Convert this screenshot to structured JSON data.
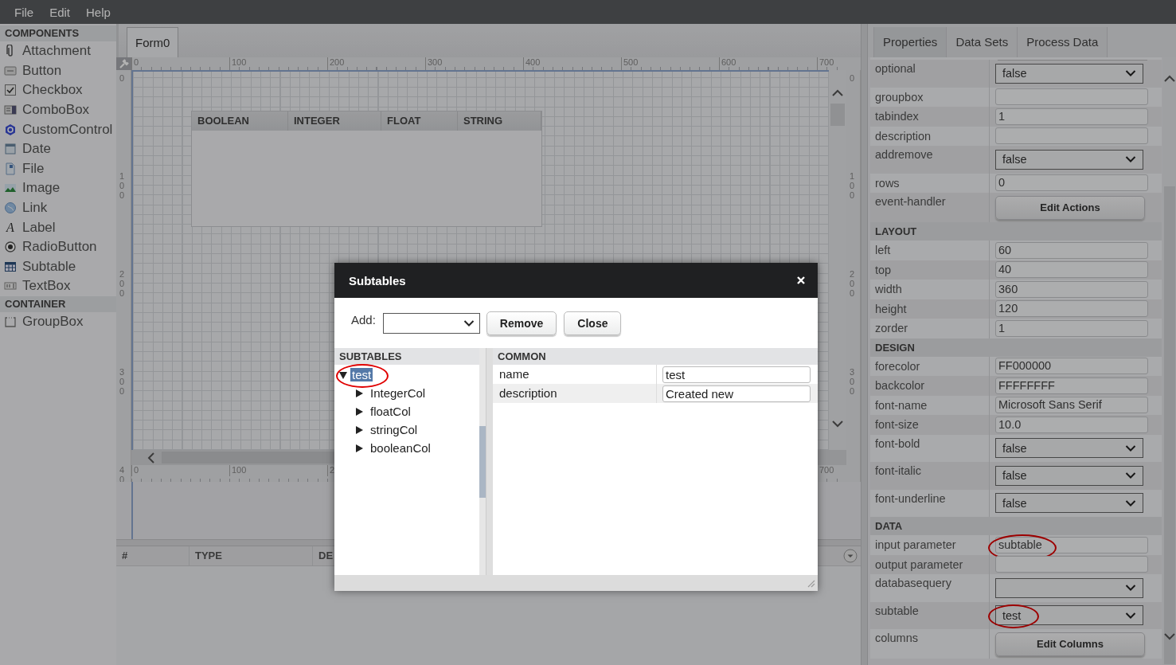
{
  "menu": [
    "File",
    "Edit",
    "Help"
  ],
  "components": {
    "title": "COMPONENTS",
    "items": [
      {
        "label": "Attachment",
        "kind": "attachment"
      },
      {
        "label": "Button",
        "kind": "button"
      },
      {
        "label": "Checkbox",
        "kind": "checkbox"
      },
      {
        "label": "ComboBox",
        "kind": "combobox"
      },
      {
        "label": "CustomControl",
        "kind": "customcontrol"
      },
      {
        "label": "Date",
        "kind": "date"
      },
      {
        "label": "File",
        "kind": "file"
      },
      {
        "label": "Image",
        "kind": "image"
      },
      {
        "label": "Link",
        "kind": "link"
      },
      {
        "label": "Label",
        "kind": "label",
        "glyph": "A"
      },
      {
        "label": "RadioButton",
        "kind": "radiobutton"
      },
      {
        "label": "Subtable",
        "kind": "subtable"
      },
      {
        "label": "TextBox",
        "kind": "textbox"
      }
    ]
  },
  "container": {
    "title": "CONTAINER",
    "items": [
      {
        "label": "GroupBox",
        "kind": "groupbox"
      }
    ]
  },
  "designer": {
    "tabs": [
      {
        "label": "Form0",
        "selected": true
      }
    ],
    "top_ruler": [
      "0",
      "100",
      "200",
      "300",
      "400",
      "500",
      "600",
      "700"
    ],
    "left_ruler": [
      "0",
      "100",
      "200",
      "300",
      "40"
    ],
    "right_ruler": [
      "0",
      "100",
      "200",
      "300"
    ],
    "bottom_ruler": [
      "0",
      "100",
      "2",
      "700"
    ],
    "subtable_columns": [
      "BOOLEAN",
      "INTEGER",
      "FLOAT",
      "STRING"
    ]
  },
  "output_table": {
    "columns": [
      "#",
      "TYPE",
      "DE"
    ]
  },
  "properties": {
    "tabs": [
      {
        "label": "Properties",
        "selected": true
      },
      {
        "label": "Data Sets",
        "selected": false
      },
      {
        "label": "Process Data",
        "selected": false
      }
    ],
    "rows": [
      {
        "kind": "select",
        "label": "optional",
        "value": "false"
      },
      {
        "kind": "text",
        "label": "groupbox"
      },
      {
        "kind": "text",
        "label": "tabindex",
        "value": "1"
      },
      {
        "kind": "text",
        "label": "description"
      },
      {
        "kind": "select",
        "label": "addremove",
        "value": "false"
      },
      {
        "kind": "text",
        "label": "rows",
        "value": "0"
      },
      {
        "kind": "button",
        "label": "event-handler",
        "value": "Edit Actions"
      },
      {
        "kind": "section",
        "label": "LAYOUT"
      },
      {
        "kind": "text",
        "label": "left",
        "value": "60"
      },
      {
        "kind": "text",
        "label": "top",
        "value": "40"
      },
      {
        "kind": "text",
        "label": "width",
        "value": "360"
      },
      {
        "kind": "text",
        "label": "height",
        "value": "120"
      },
      {
        "kind": "text",
        "label": "zorder",
        "value": "1"
      },
      {
        "kind": "section",
        "label": "DESIGN"
      },
      {
        "kind": "text",
        "label": "forecolor",
        "value": "FF000000"
      },
      {
        "kind": "text",
        "label": "backcolor",
        "value": "FFFFFFFF"
      },
      {
        "kind": "text",
        "label": "font-name",
        "value": "Microsoft Sans Serif"
      },
      {
        "kind": "text",
        "label": "font-size",
        "value": "10.0"
      },
      {
        "kind": "select",
        "label": "font-bold",
        "value": "false"
      },
      {
        "kind": "select",
        "label": "font-italic",
        "value": "false"
      },
      {
        "kind": "select",
        "label": "font-underline",
        "value": "false"
      },
      {
        "kind": "section",
        "label": "DATA"
      },
      {
        "kind": "text",
        "label": "input parameter",
        "value": "subtable",
        "circled": true
      },
      {
        "kind": "text",
        "label": "output parameter"
      },
      {
        "kind": "select",
        "label": "databasequery"
      },
      {
        "kind": "select",
        "label": "subtable",
        "value": "test",
        "circled": true
      },
      {
        "kind": "button",
        "label": "columns",
        "value": "Edit Columns"
      }
    ]
  },
  "dialog": {
    "title": "Subtables",
    "add": {
      "label": "Add:"
    },
    "buttons": [
      "Remove",
      "Close"
    ],
    "tree": {
      "title": "SUBTABLES",
      "nodes": [
        {
          "label": "test",
          "expanded": true,
          "selected": true,
          "circled": true,
          "children": [
            {
              "label": "IntegerCol",
              "expanded": false
            },
            {
              "label": "floatCol",
              "expanded": false
            },
            {
              "label": "stringCol",
              "expanded": false
            },
            {
              "label": "booleanCol",
              "expanded": false
            }
          ]
        }
      ]
    },
    "common": {
      "title": "COMMON",
      "rows": [
        {
          "label": "name",
          "value": "test"
        },
        {
          "label": "description",
          "value": "Created new"
        }
      ]
    }
  }
}
